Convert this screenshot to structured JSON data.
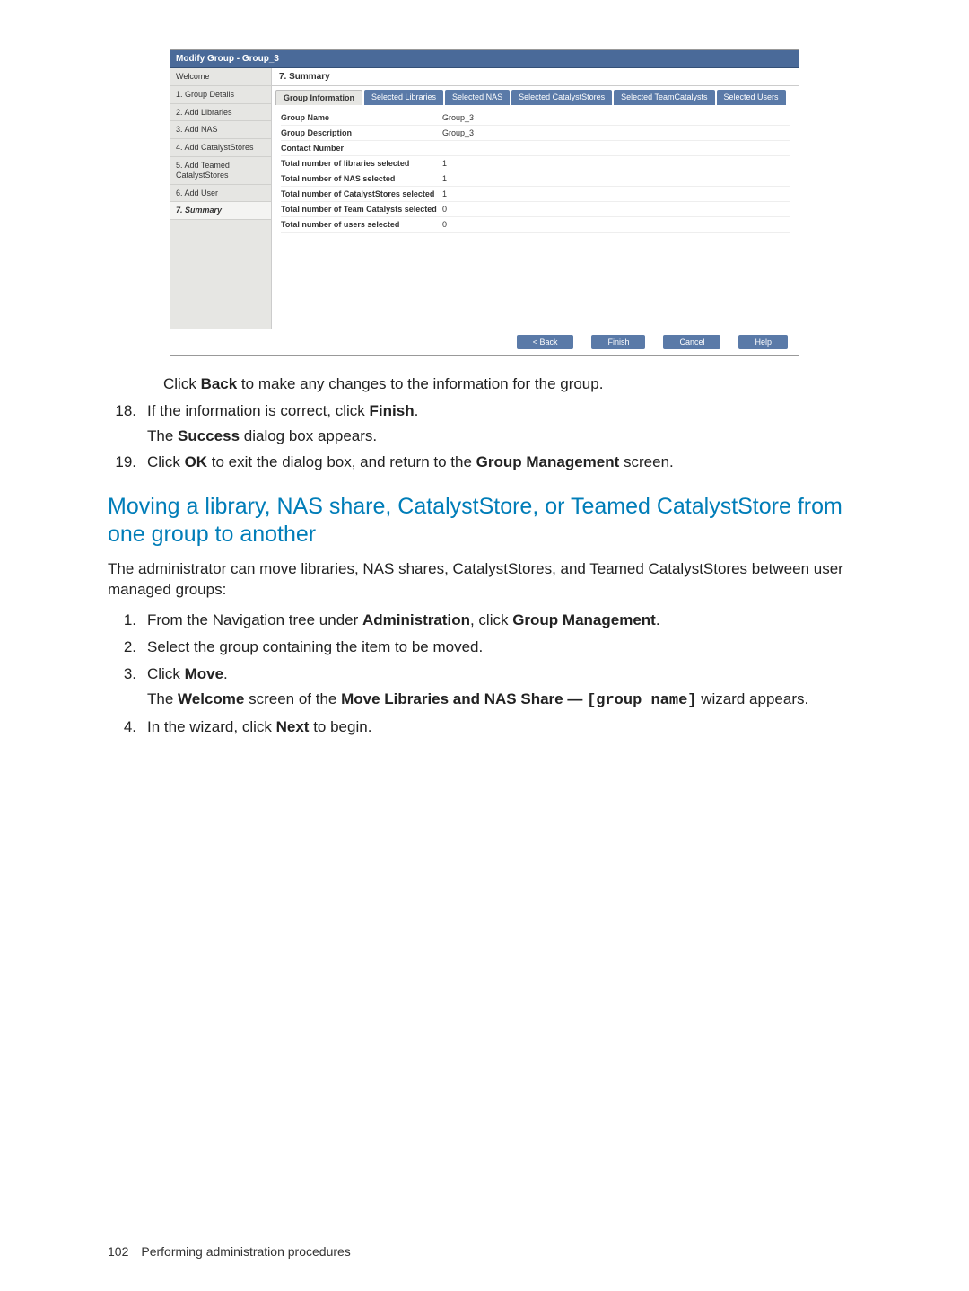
{
  "screenshot": {
    "titlebar": "Modify Group - Group_3",
    "steps": [
      "Welcome",
      "1. Group Details",
      "2. Add Libraries",
      "3. Add NAS",
      "4. Add CatalystStores",
      "5. Add Teamed CatalystStores",
      "6. Add User",
      "7. Summary"
    ],
    "active_step_index": 7,
    "summary_head": "7. Summary",
    "tabs": [
      "Group Information",
      "Selected Libraries",
      "Selected NAS",
      "Selected CatalystStores",
      "Selected TeamCatalysts",
      "Selected Users"
    ],
    "active_tab_index": 0,
    "rows": [
      {
        "k": "Group Name",
        "v": "Group_3"
      },
      {
        "k": "Group Description",
        "v": "Group_3"
      },
      {
        "k": "Contact Number",
        "v": ""
      },
      {
        "k": "Total number of libraries selected",
        "v": "1"
      },
      {
        "k": "Total number of NAS selected",
        "v": "1"
      },
      {
        "k": "Total number of CatalystStores selected",
        "v": "1"
      },
      {
        "k": "Total number of Team Catalysts selected",
        "v": "0"
      },
      {
        "k": "Total number of users selected",
        "v": "0"
      }
    ],
    "buttons": [
      "< Back",
      "Finish",
      "Cancel",
      "Help"
    ]
  },
  "body": {
    "para_back_1": "Click ",
    "para_back_b": "Back",
    "para_back_2": " to make any changes to the information for the group.",
    "s18_n": "18.",
    "s18_1": "If the information is correct, click ",
    "s18_b": "Finish",
    "s18_2": ".",
    "s18_cont_1": "The ",
    "s18_cont_b": "Success",
    "s18_cont_2": " dialog box appears.",
    "s19_n": "19.",
    "s19_1": "Click ",
    "s19_b1": "OK",
    "s19_2": " to exit the dialog box, and return to the ",
    "s19_b2": "Group Management",
    "s19_3": " screen.",
    "section_title": "Moving a library, NAS share, CatalystStore, or Teamed CatalystStore from one group to another",
    "intro": "The administrator can move libraries, NAS shares, CatalystStores, and Teamed CatalystStores between user managed groups:",
    "m1_n": "1.",
    "m1_1": "From the Navigation tree under ",
    "m1_b1": "Administration",
    "m1_2": ", click ",
    "m1_b2": "Group Management",
    "m1_3": ".",
    "m2_n": "2.",
    "m2_1": "Select the group containing the item to be moved.",
    "m3_n": "3.",
    "m3_1": "Click ",
    "m3_b": "Move",
    "m3_2": ".",
    "m3_cont_1": "The ",
    "m3_cont_b1": "Welcome",
    "m3_cont_2": " screen of the ",
    "m3_cont_b2": "Move Libraries and NAS Share — ",
    "m3_cont_mono": "[group name]",
    "m3_cont_3": " wizard appears.",
    "m4_n": "4.",
    "m4_1": "In the wizard, click ",
    "m4_b": "Next",
    "m4_2": " to begin."
  },
  "footer": {
    "page": "102",
    "title": "Performing administration procedures"
  }
}
